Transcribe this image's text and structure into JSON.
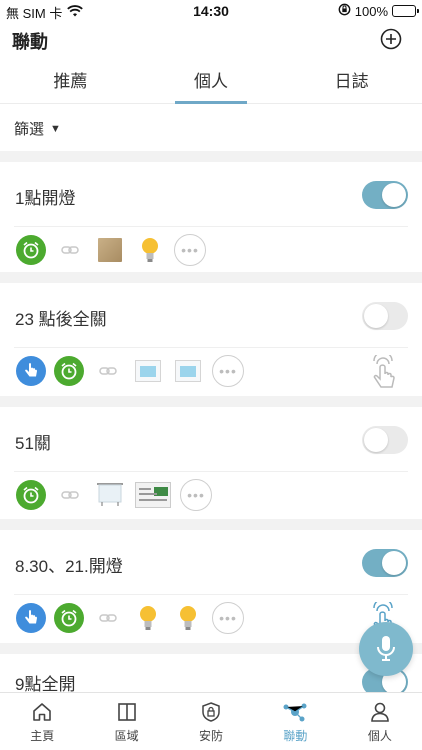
{
  "status_bar": {
    "carrier": "無 SIM 卡",
    "time": "14:30",
    "battery": "100%"
  },
  "header": {
    "title": "聯動"
  },
  "tabs": [
    {
      "label": "推薦"
    },
    {
      "label": "個人"
    },
    {
      "label": "日誌"
    }
  ],
  "active_tab": "個人",
  "filter": {
    "label": "篩選"
  },
  "linkages": [
    {
      "name": "1點開燈",
      "enabled": true
    },
    {
      "name": "23 點後全關",
      "enabled": false
    },
    {
      "name": "51關",
      "enabled": false
    },
    {
      "name": "8.30、21.開燈",
      "enabled": true
    },
    {
      "name": "9點全開",
      "enabled": true
    }
  ],
  "bottom_nav": [
    {
      "label": "主頁"
    },
    {
      "label": "區域"
    },
    {
      "label": "安防"
    },
    {
      "label": "聯動"
    },
    {
      "label": "個人"
    }
  ],
  "colors": {
    "accent": "#73afc4",
    "clock_green": "#4caa2f",
    "hand_blue": "#3f8ddc",
    "nav_active": "#5aa3c8"
  }
}
